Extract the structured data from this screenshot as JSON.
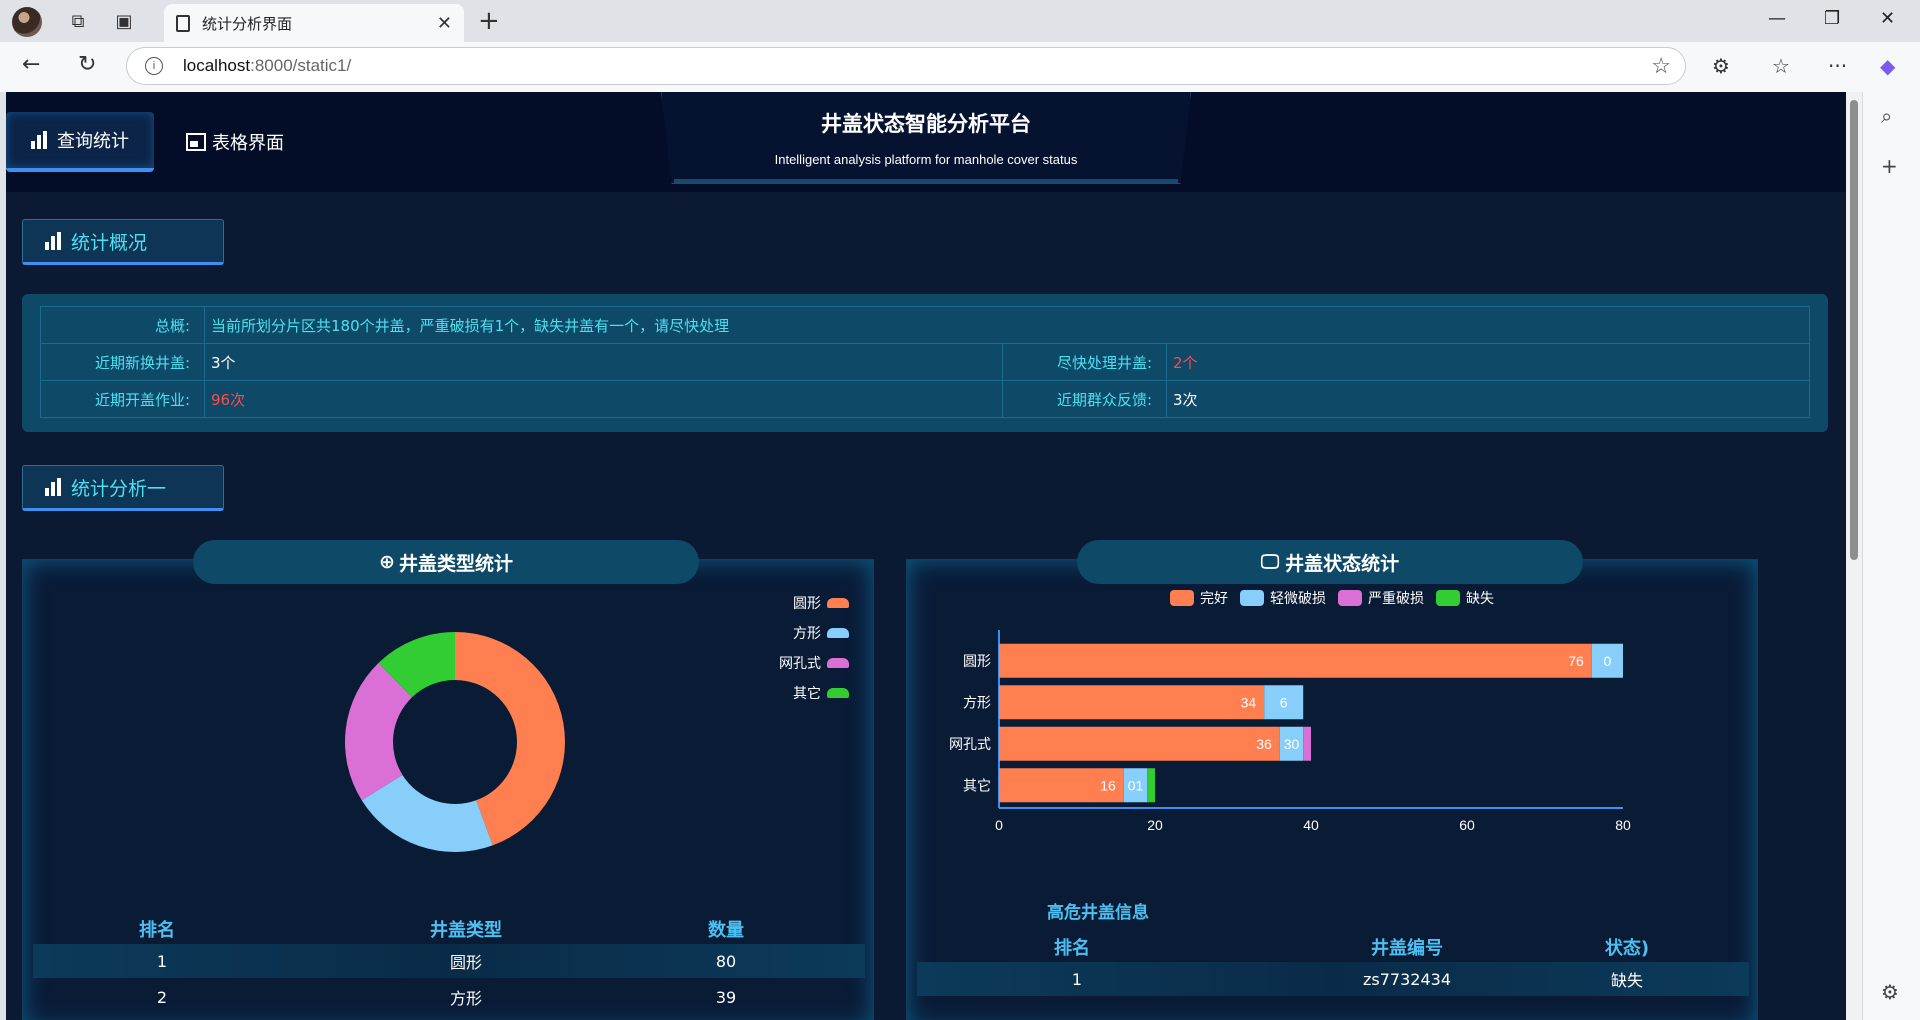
{
  "browser": {
    "tab_title": "统计分析界面",
    "url_host": "localhost",
    "url_path": ":8000/static1/"
  },
  "nav": {
    "tab1": "查询统计",
    "tab2": "表格界面"
  },
  "header": {
    "title": "井盖状态智能分析平台",
    "subtitle": "Intelligent analysis platform for manhole cover status"
  },
  "section1": {
    "title": "统计概况"
  },
  "overview": {
    "summary_label": "总概:",
    "summary_text": "当前所划分片区共180个井盖，严重破损有1个，缺失井盖有一个，请尽快处理",
    "new_label": "近期新换井盖:",
    "new_value": "3个",
    "urgent_label": "尽快处理井盖:",
    "urgent_value": "2个",
    "open_label": "近期开盖作业:",
    "open_value": "96次",
    "feedback_label": "近期群众反馈:",
    "feedback_value": "3次"
  },
  "section2": {
    "title": "统计分析一"
  },
  "left_panel": {
    "title": "井盖类型统计",
    "table_headers": [
      "排名",
      "井盖类型",
      "数量"
    ],
    "rows": [
      [
        "1",
        "圆形",
        "80"
      ],
      [
        "2",
        "方形",
        "39"
      ]
    ]
  },
  "right_panel": {
    "title": "井盖状态统计",
    "subtitle": "高危井盖信息",
    "table_headers": [
      "排名",
      "井盖编号",
      "状态)"
    ],
    "rows": [
      [
        "1",
        "zs7732434",
        "缺失"
      ]
    ]
  },
  "chart_data": [
    {
      "type": "pie",
      "variant": "donut",
      "labels": [
        "圆形",
        "方形",
        "网孔式",
        "其它"
      ],
      "values": [
        80,
        39,
        39,
        22
      ],
      "colors": [
        "#ff7f50",
        "#87cefa",
        "#da70d6",
        "#32cd32"
      ],
      "legend_position": "top-right"
    },
    {
      "type": "bar",
      "orientation": "horizontal",
      "stacked": true,
      "categories": [
        "圆形",
        "方形",
        "网孔式",
        "其它"
      ],
      "series": [
        {
          "name": "完好",
          "values": [
            76,
            34,
            36,
            16
          ],
          "color": "#ff7f50"
        },
        {
          "name": "轻微破损",
          "values": [
            4,
            5,
            3,
            3
          ],
          "color": "#87cefa"
        },
        {
          "name": "严重破损",
          "values": [
            0,
            0,
            1,
            0
          ],
          "color": "#da70d6"
        },
        {
          "name": "缺失",
          "values": [
            0,
            0,
            0,
            1
          ],
          "color": "#32cd32"
        }
      ],
      "data_labels": [
        [
          "76",
          "0"
        ],
        [
          "34",
          "6"
        ],
        [
          "36",
          "30"
        ],
        [
          "16",
          "01"
        ]
      ],
      "xticks": [
        0,
        20,
        40,
        60,
        80
      ],
      "xlim": [
        0,
        80
      ],
      "legend_position": "top"
    }
  ]
}
